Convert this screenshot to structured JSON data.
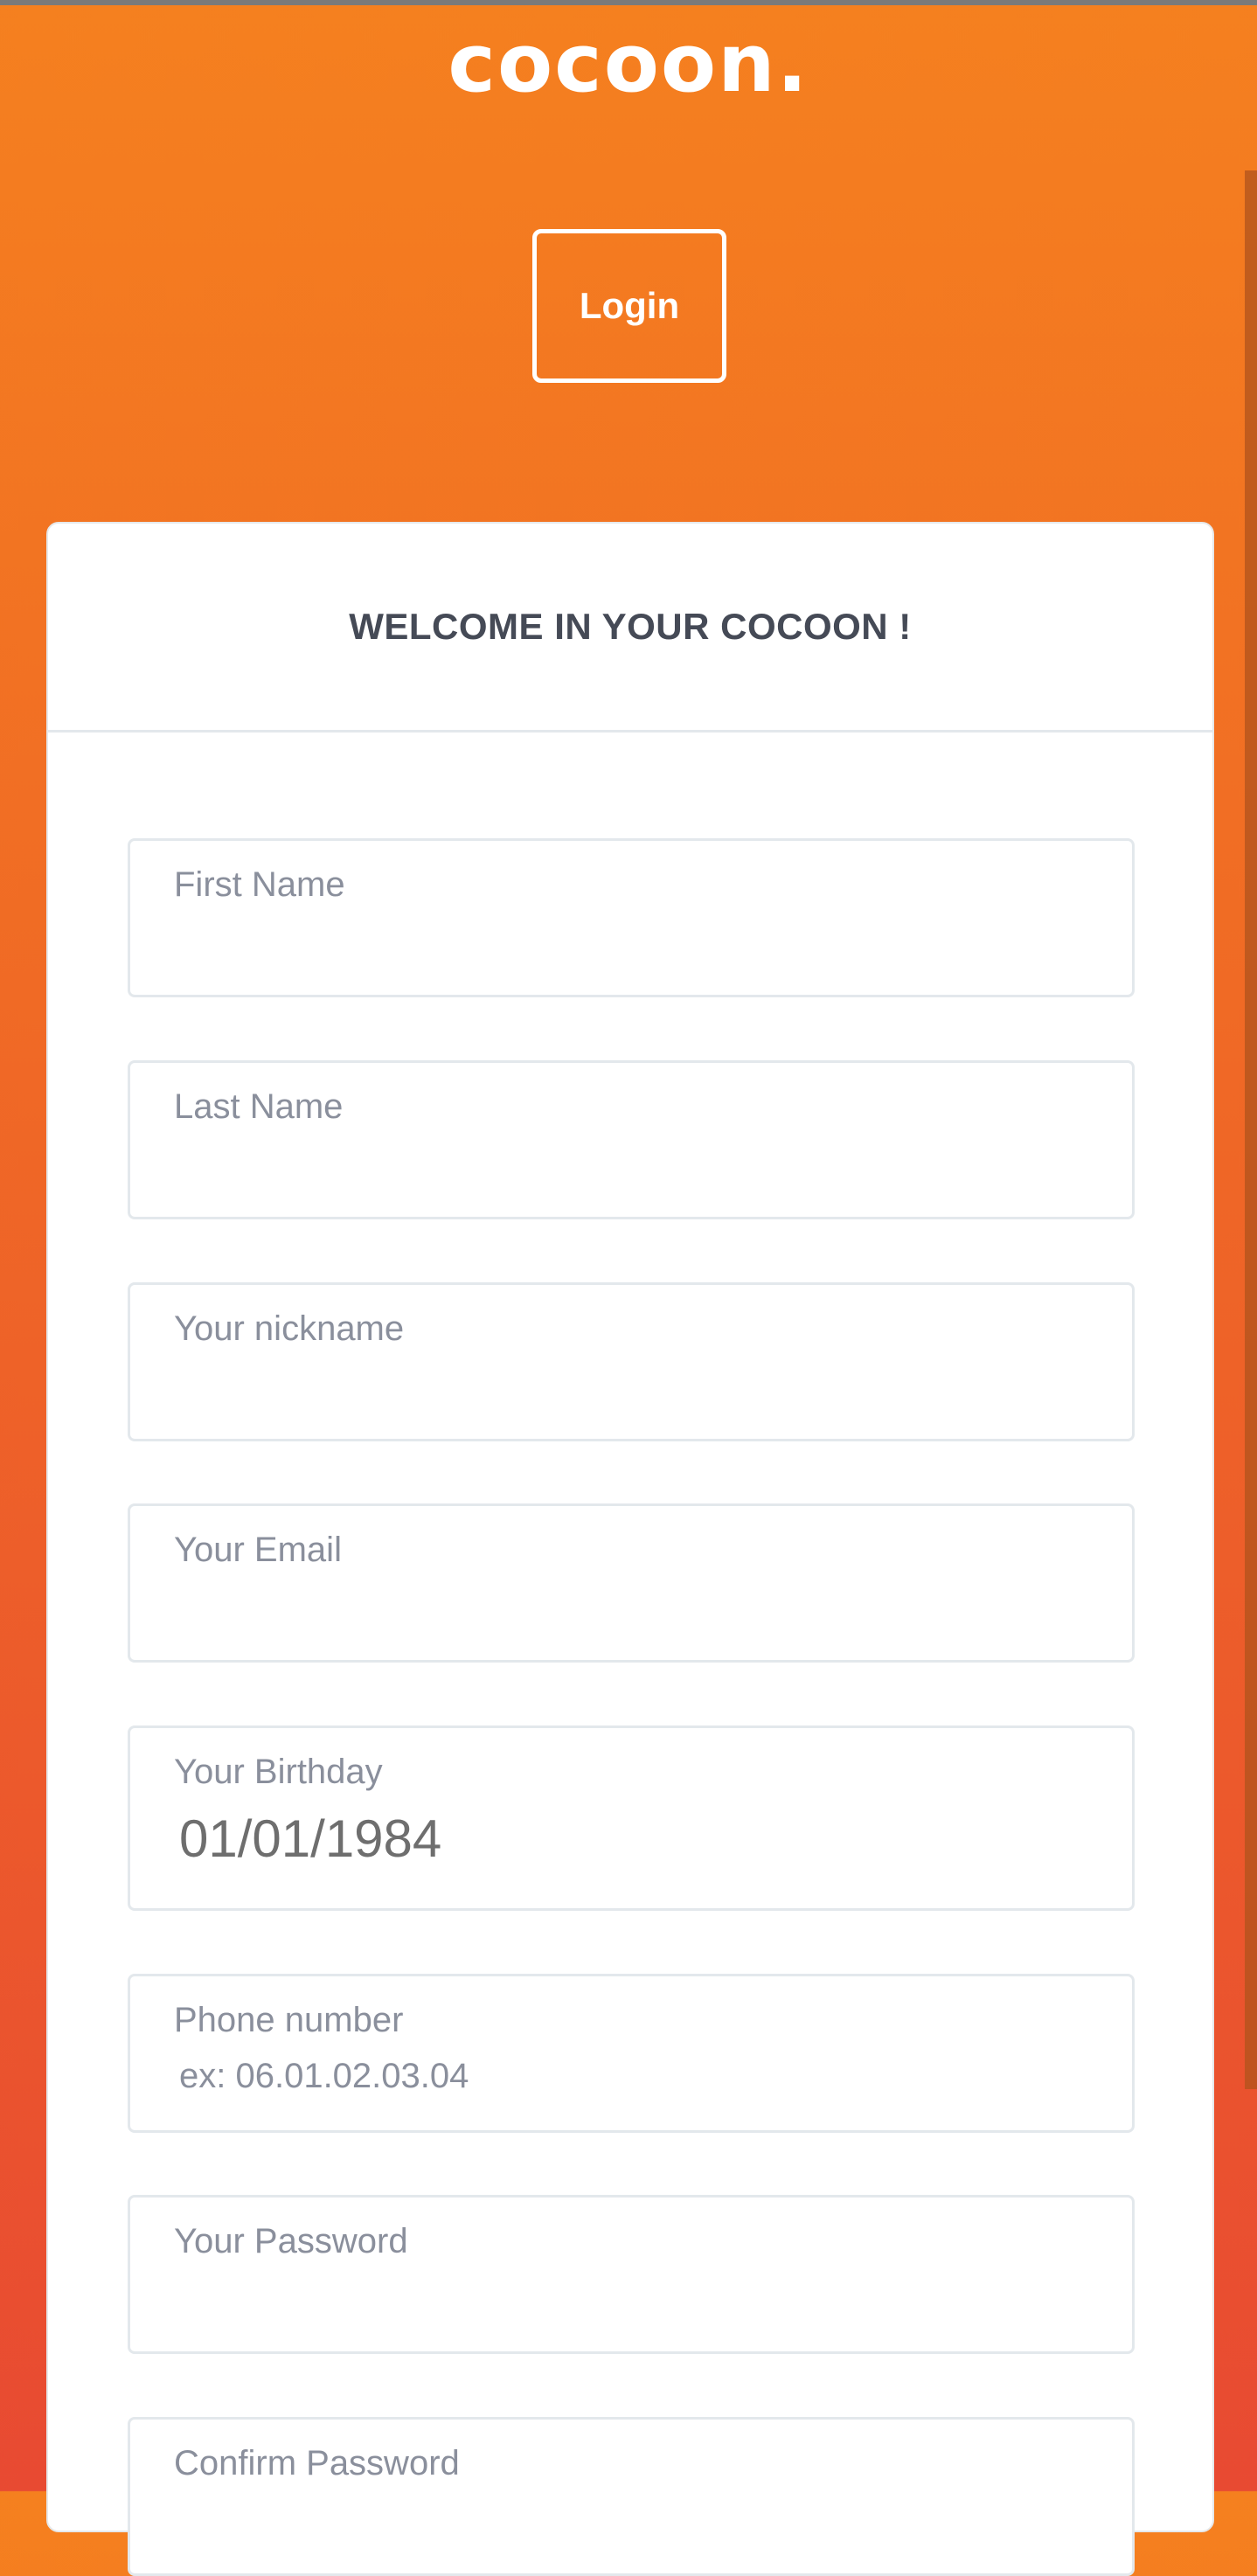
{
  "brand": {
    "logo_text": "cocoon."
  },
  "header": {
    "login_label": "Login"
  },
  "form": {
    "title": "WELCOME IN YOUR COCOON !",
    "fields": {
      "first_name": {
        "label": "First Name"
      },
      "last_name": {
        "label": "Last Name"
      },
      "nickname": {
        "label": "Your nickname"
      },
      "email": {
        "label": "Your Email"
      },
      "birthday": {
        "label": "Your Birthday",
        "value": "01/01/1984"
      },
      "phone": {
        "label": "Phone number",
        "placeholder": "ex: 06.01.02.03.04"
      },
      "password": {
        "label": "Your Password"
      },
      "confirm_password": {
        "label": "Confirm Password"
      }
    }
  },
  "colors": {
    "gradient_top": "#f5801f",
    "gradient_bottom": "#e84a32",
    "title_text": "#454a56",
    "label_text": "#8a8f9c"
  }
}
